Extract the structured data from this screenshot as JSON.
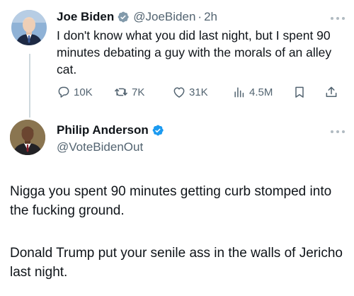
{
  "original_tweet": {
    "author_name": "Joe Biden",
    "handle": "@JoeBiden",
    "separator": "·",
    "time": "2h",
    "text": "I don't know what you did last night, but I spent 90 minutes debating a guy with the morals of an alley cat.",
    "stats": {
      "replies": "10K",
      "retweets": "7K",
      "likes": "31K",
      "views": "4.5M"
    }
  },
  "reply_tweet": {
    "author_name": "Philip Anderson",
    "handle": "@VoteBidenOut",
    "paragraphs": [
      "Nigga you spent 90 minutes getting curb stomped into the fucking ground.",
      "Donald Trump put your senile ass in the walls of Jericho last night."
    ]
  },
  "colors": {
    "verified_badge": "#1d9bf0",
    "secondary_text": "#536471",
    "thread_line": "#cfd9de"
  },
  "icons": [
    "reply-icon",
    "retweet-icon",
    "like-icon",
    "views-icon",
    "bookmark-icon",
    "share-icon",
    "verified-badge-icon",
    "more-icon"
  ]
}
